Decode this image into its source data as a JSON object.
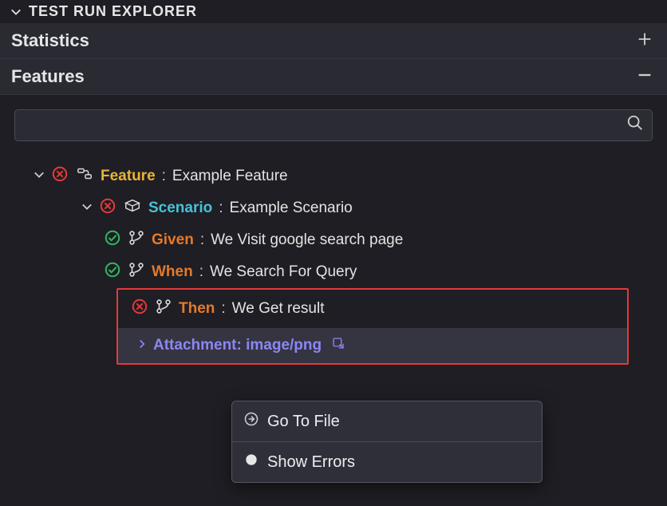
{
  "panel": {
    "title": "TEST RUN EXPLORER"
  },
  "sections": {
    "statistics": {
      "label": "Statistics"
    },
    "features": {
      "label": "Features"
    }
  },
  "search": {
    "placeholder": ""
  },
  "tree": {
    "feature": {
      "keyword": "Feature",
      "name": "Example Feature",
      "status": "failed"
    },
    "scenario": {
      "keyword": "Scenario",
      "name": "Example Scenario",
      "status": "failed"
    },
    "steps": [
      {
        "keyword": "Given",
        "name": "We Visit google search page",
        "status": "passed"
      },
      {
        "keyword": "When",
        "name": "We Search For Query",
        "status": "passed"
      },
      {
        "keyword": "Then",
        "name": "We Get result",
        "status": "failed"
      }
    ],
    "attachment": {
      "label": "Attachment: image/png"
    }
  },
  "contextMenu": {
    "items": [
      {
        "label": "Go To File",
        "icon": "goto"
      },
      {
        "label": "Show Errors",
        "icon": "circle"
      }
    ]
  },
  "icons": {
    "chevronDown": "chevron-down",
    "chevronRight": "chevron-right",
    "fail": "fail-circle",
    "pass": "pass-circle",
    "feature": "feature",
    "scenario": "scenario",
    "branch": "branch",
    "popout": "popout",
    "search": "search",
    "plus": "plus",
    "minus": "minus"
  }
}
